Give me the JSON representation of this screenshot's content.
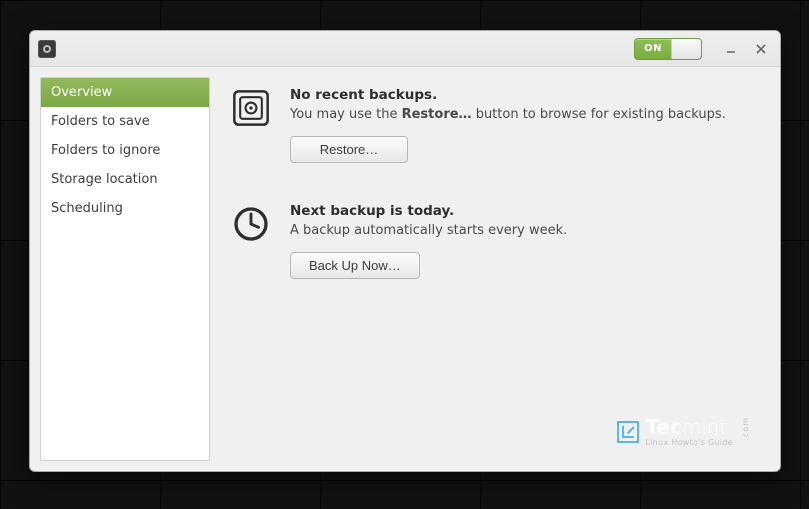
{
  "titlebar": {
    "toggle_label": "ON"
  },
  "sidebar": {
    "items": [
      {
        "label": "Overview",
        "active": true
      },
      {
        "label": "Folders to save",
        "active": false
      },
      {
        "label": "Folders to ignore",
        "active": false
      },
      {
        "label": "Storage location",
        "active": false
      },
      {
        "label": "Scheduling",
        "active": false
      }
    ]
  },
  "sections": {
    "backup_status": {
      "title": "No recent backups.",
      "sub_prefix": "You may use the ",
      "sub_bold": "Restore…",
      "sub_suffix": " button to browse for existing backups.",
      "button": "Restore…"
    },
    "schedule": {
      "title": "Next backup is today.",
      "sub": "A backup automatically starts every week.",
      "button": "Back Up Now…"
    }
  },
  "watermark": {
    "brand_bold": "Tec",
    "brand_light": "mint",
    "tagline": "Linux Howto's Guide",
    "suffix": ".com"
  }
}
